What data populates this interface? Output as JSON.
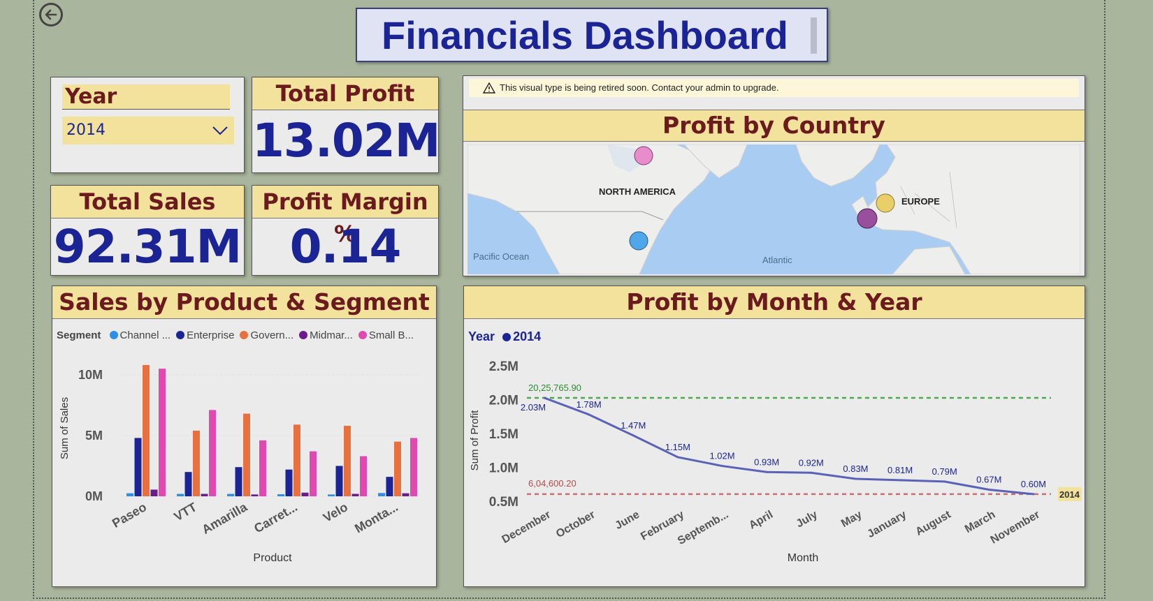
{
  "title": "Financials Dashboard",
  "year_slicer": {
    "label": "Year",
    "value": "2014"
  },
  "kpis": {
    "total_profit": {
      "label": "Total Profit",
      "value": "13.02M"
    },
    "total_sales": {
      "label": "Total Sales",
      "value": "92.31M"
    },
    "profit_margin": {
      "label": "Profit Margin %",
      "value": "0.14"
    }
  },
  "map": {
    "warning": "This visual type is being retired soon. Contact your admin to upgrade.",
    "title": "Profit by Country",
    "labels": {
      "north_america": "NORTH AMERICA",
      "europe": "EUROPE",
      "pacific": "Pacific Ocean",
      "atlantic": "Atlantic"
    },
    "colors": {
      "water": "#a9cdf2",
      "land": "#eeeeec",
      "canada": "#e88ccc",
      "usa": "#4fa6e8",
      "germany": "#e8cf6a",
      "france": "#9a4e9e"
    }
  },
  "bar_chart": {
    "title": "Sales by Product & Segment",
    "legend_title": "Segment",
    "legend": [
      "Channel ...",
      "Enterprise",
      "Govern...",
      "Midmar...",
      "Small B..."
    ],
    "xaxis_title": "Product",
    "yaxis_title": "Sum of Sales"
  },
  "line_chart": {
    "title": "Profit by Month & Year",
    "legend_title": "Year",
    "legend_item": "2014",
    "xaxis_title": "Month",
    "yaxis_title": "Sum of Profit",
    "max_line_label": "20,25,765.90",
    "min_line_label": "6,04,600.20",
    "end_tag": "2014"
  },
  "chart_data": [
    {
      "type": "bar",
      "title": "Sales by Product & Segment",
      "xlabel": "Product",
      "ylabel": "Sum of Sales",
      "categories": [
        "Paseo",
        "VTT",
        "Amarilla",
        "Carret...",
        "Velo",
        "Monta..."
      ],
      "yticks": [
        "0M",
        "5M",
        "10M"
      ],
      "ylim": [
        0,
        11200000
      ],
      "series": [
        {
          "name": "Channel ...",
          "color": "#2f8fe8",
          "values": [
            250000,
            200000,
            200000,
            170000,
            150000,
            270000
          ]
        },
        {
          "name": "Enterprise",
          "color": "#1b2494",
          "values": [
            4800000,
            2000000,
            2400000,
            2200000,
            2500000,
            1600000
          ]
        },
        {
          "name": "Govern...",
          "color": "#e8703e",
          "values": [
            10800000,
            5400000,
            6800000,
            5900000,
            5800000,
            4500000
          ]
        },
        {
          "name": "Midmar...",
          "color": "#6b1b8c",
          "values": [
            550000,
            200000,
            150000,
            300000,
            200000,
            250000
          ]
        },
        {
          "name": "Small B...",
          "color": "#e04ab0",
          "values": [
            10500000,
            7100000,
            4600000,
            3700000,
            3300000,
            4800000
          ]
        }
      ]
    },
    {
      "type": "line",
      "title": "Profit by Month & Year",
      "xlabel": "Month",
      "ylabel": "Sum of Profit",
      "x": [
        "December",
        "October",
        "June",
        "February",
        "Septemb...",
        "April",
        "July",
        "May",
        "January",
        "August",
        "March",
        "November"
      ],
      "yticks": [
        "0.5M",
        "1.0M",
        "1.5M",
        "2.0M",
        "2.5M"
      ],
      "ylim": [
        500000,
        2500000
      ],
      "series": [
        {
          "name": "2014",
          "color": "#5a62b8",
          "values": [
            2025765.9,
            1780000,
            1470000,
            1150000,
            1020000,
            930000,
            920000,
            830000,
            810000,
            790000,
            670000,
            604600.2
          ],
          "labels": [
            "2.03M",
            "1.78M",
            "1.47M",
            "1.15M",
            "1.02M",
            "0.93M",
            "0.92M",
            "0.83M",
            "0.81M",
            "0.79M",
            "0.67M",
            "0.60M"
          ]
        }
      ],
      "max_line": 2025765.9,
      "min_line": 604600.2
    }
  ]
}
